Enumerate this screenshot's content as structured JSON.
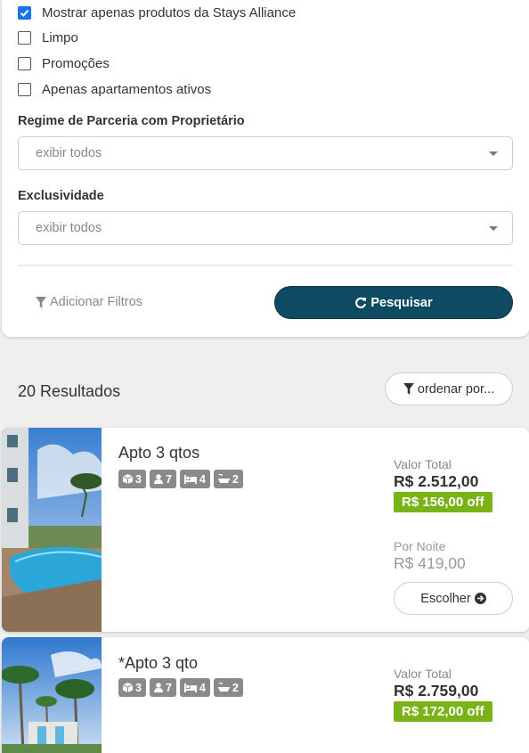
{
  "filters": {
    "checkboxes": [
      {
        "label": "Mostrar apenas produtos da Stays Alliance",
        "checked": true
      },
      {
        "label": "Limpo",
        "checked": false
      },
      {
        "label": "Promoções",
        "checked": false
      },
      {
        "label": "Apenas apartamentos ativos",
        "checked": false
      }
    ],
    "partnership": {
      "label": "Regime de Parceria com Proprietário",
      "value": "exibir todos"
    },
    "exclusivity": {
      "label": "Exclusividade",
      "value": "exibir todos"
    },
    "add_filters_label": "Adicionar Filtros",
    "search_label": "Pesquisar"
  },
  "results": {
    "count_label": "20 Resultados",
    "order_label": "ordenar por..."
  },
  "listings": [
    {
      "title": "Apto 3 qtos",
      "badges": {
        "rooms": "3",
        "guests": "7",
        "beds": "4",
        "baths": "2"
      },
      "total_label": "Valor Total",
      "total": "R$ 2.512,00",
      "discount": "R$ 156,00 off",
      "night_label": "Por Noite",
      "night": "R$ 419,00",
      "choose_label": "Escolher"
    },
    {
      "title": "*Apto 3 qto",
      "badges": {
        "rooms": "3",
        "guests": "7",
        "beds": "4",
        "baths": "2"
      },
      "total_label": "Valor Total",
      "total": "R$ 2.759,00",
      "discount": "R$ 172,00 off"
    }
  ],
  "colors": {
    "primary": "#0f4a63",
    "discount": "#7ab317",
    "badge": "#8a8a8a",
    "checkbox": "#1a73e8"
  }
}
